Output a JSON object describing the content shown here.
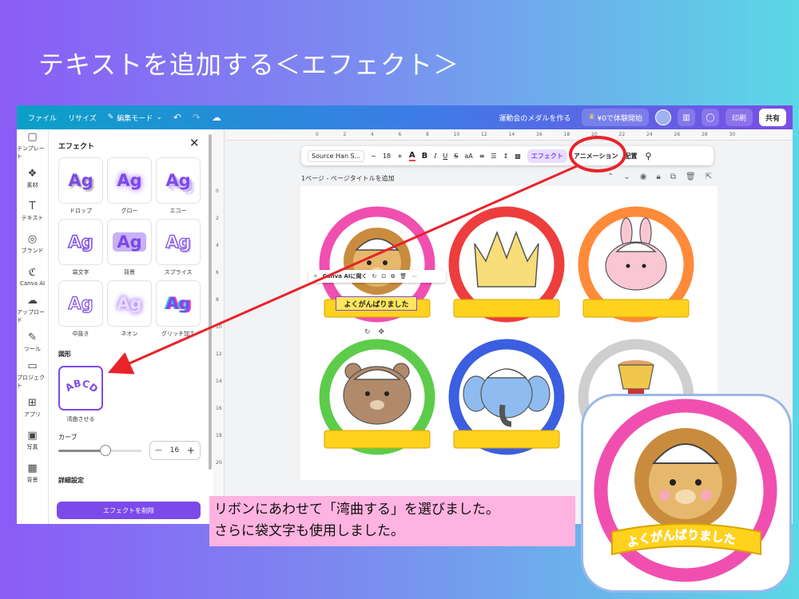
{
  "slide_title": "テキストを追加する＜エフェクト＞",
  "topbar": {
    "file": "ファイル",
    "resize": "リサイズ",
    "edit_mode": "編集モード",
    "doc_title": "運動会のメダルを作る",
    "trial": "¥0で体験開始",
    "print": "印刷",
    "share": "共有"
  },
  "rail": [
    {
      "icon": "template-icon",
      "glyph": "▢",
      "label": "テンプレート"
    },
    {
      "icon": "elements-icon",
      "glyph": "❖",
      "label": "素材"
    },
    {
      "icon": "text-icon",
      "glyph": "T",
      "label": "テキスト"
    },
    {
      "icon": "brand-icon",
      "glyph": "◎",
      "label": "ブランド"
    },
    {
      "icon": "canva-ai-icon",
      "glyph": "ℭ",
      "label": "Canva AI"
    },
    {
      "icon": "upload-icon",
      "glyph": "☁",
      "label": "アップロード"
    },
    {
      "icon": "tools-icon",
      "glyph": "✎",
      "label": "ツール"
    },
    {
      "icon": "project-icon",
      "glyph": "▭",
      "label": "プロジェクト"
    },
    {
      "icon": "apps-icon",
      "glyph": "⊞",
      "label": "アプリ"
    },
    {
      "icon": "photo-icon",
      "glyph": "▣",
      "label": "写真"
    },
    {
      "icon": "background-icon",
      "glyph": "▦",
      "label": "背景"
    }
  ],
  "panel": {
    "title": "エフェクト",
    "effects": [
      {
        "sample": "Ag",
        "label": "ドロップ"
      },
      {
        "sample": "Ag",
        "label": "グロー"
      },
      {
        "sample": "Ag",
        "label": "エコー"
      },
      {
        "sample": "Ag",
        "label": "袋文字"
      },
      {
        "sample": "Ag",
        "label": "背景"
      },
      {
        "sample": "Ag",
        "label": "スプライス"
      },
      {
        "sample": "Ag",
        "label": "中抜き"
      },
      {
        "sample": "Ag",
        "label": "ネオン"
      },
      {
        "sample": "Ag",
        "label": "グリッチ加工"
      }
    ],
    "shape_section": "図形",
    "curve_sample": "ABCD",
    "curve_label": "湾曲させる",
    "curve_heading": "カーブ",
    "curve_value": "16",
    "detail_section": "詳細設定",
    "remove_button": "エフェクトを削除"
  },
  "ruler_top": [
    "0",
    "2",
    "4",
    "6",
    "8",
    "10",
    "12",
    "14",
    "16",
    "18",
    "20",
    "22",
    "24",
    "26",
    "28",
    "30"
  ],
  "ruler_left": [
    "0",
    "2",
    "4",
    "6",
    "8",
    "10",
    "12",
    "14",
    "16",
    "18",
    "20"
  ],
  "toolbar": {
    "font": "Source Han S...",
    "minus": "−",
    "size": "18",
    "plus": "+",
    "color": "A",
    "bold": "B",
    "italic": "I",
    "underline": "U",
    "strike": "S",
    "case": "aA",
    "effects": "エフェクト",
    "animation": "アニメーション",
    "position": "配置"
  },
  "page_label": "1ページ - ページタイトルを追加",
  "context_menu": {
    "ai": "Canva AIに聞く"
  },
  "selected_text": "よくがんばりました",
  "medals": [
    {
      "color": "#f04fb0",
      "animal": "lion"
    },
    {
      "color": "#ee3d3d",
      "animal": "crown"
    },
    {
      "color": "#ff8a3a",
      "animal": "rabbit"
    },
    {
      "color": "#5dcc4a",
      "animal": "bear"
    },
    {
      "color": "#3b5fe0",
      "animal": "elephant"
    },
    {
      "color": "#cfcfcf",
      "animal": "trophy"
    }
  ],
  "callout": {
    "line1": "リボンにあわせて「湾曲する」を選びました。",
    "line2": "さらに袋文字も使用しました。"
  },
  "zoom_ribbon_text": "よくがんばりました",
  "colors": {
    "accent": "#7c4ae8",
    "highlight": "#e8232a"
  }
}
